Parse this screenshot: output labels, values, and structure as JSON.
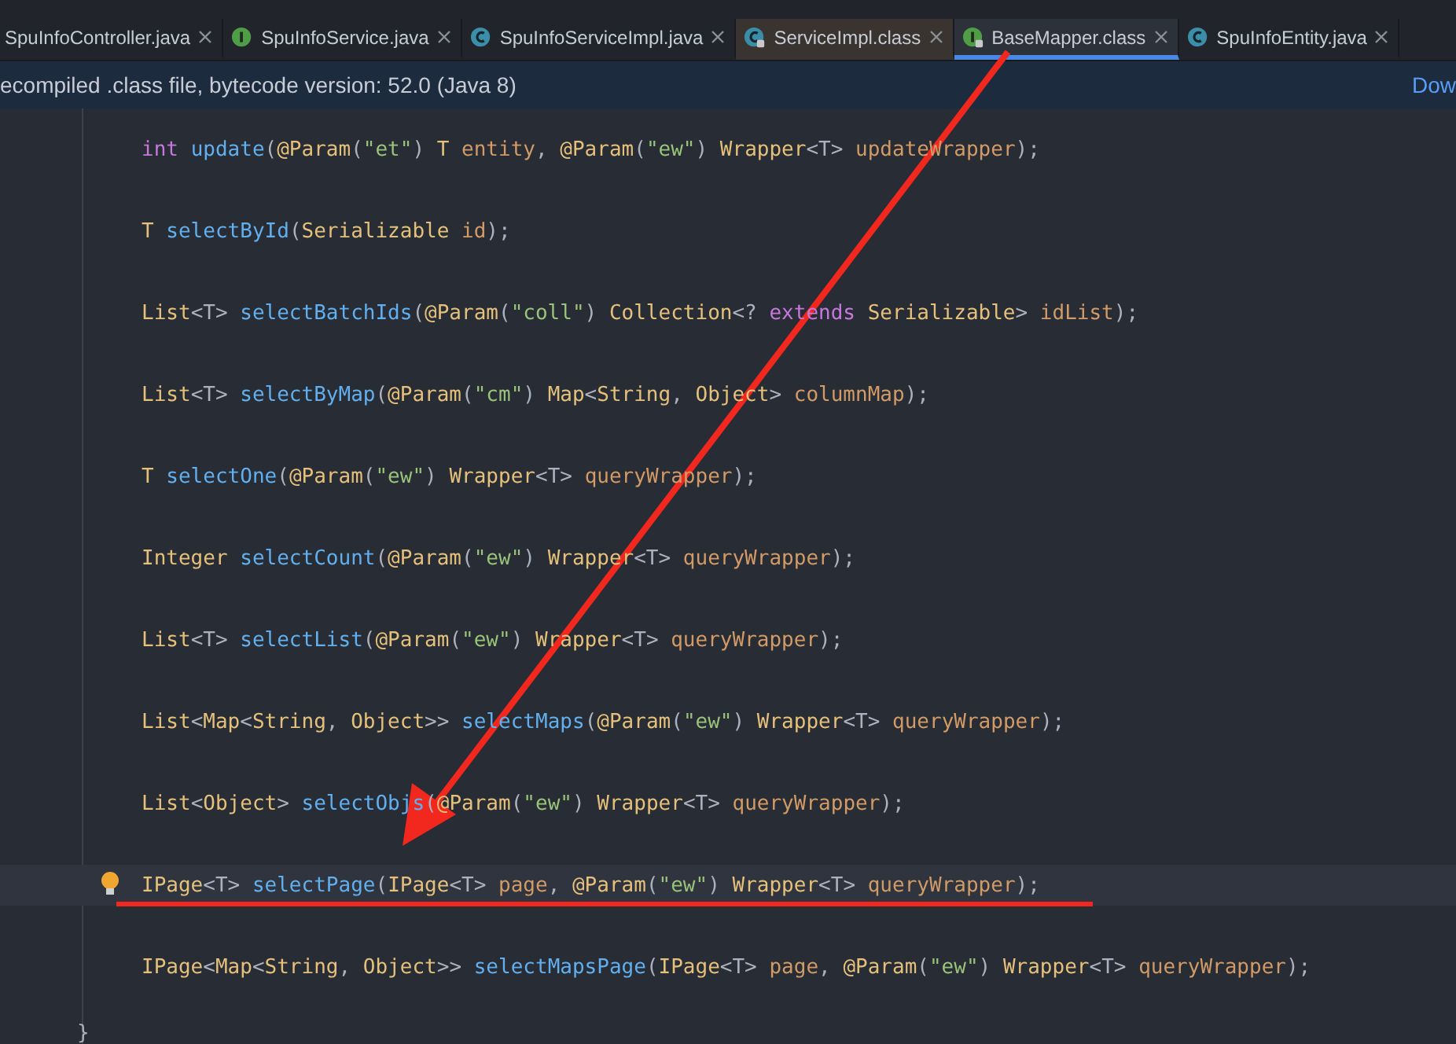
{
  "tabs": [
    {
      "label": "SpuInfoController.java",
      "kind": "none",
      "locked": false,
      "selected": false
    },
    {
      "label": "SpuInfoService.java",
      "kind": "interface",
      "locked": false,
      "selected": false
    },
    {
      "label": "SpuInfoServiceImpl.java",
      "kind": "class",
      "locked": false,
      "selected": false
    },
    {
      "label": "ServiceImpl.class",
      "kind": "class",
      "locked": true,
      "selected": false
    },
    {
      "label": "BaseMapper.class",
      "kind": "interface",
      "locked": true,
      "selected": true
    },
    {
      "label": "SpuInfoEntity.java",
      "kind": "class",
      "locked": false,
      "selected": false
    }
  ],
  "banner": {
    "text": "ecompiled .class file, bytecode version: 52.0 (Java 8)",
    "link": "Dow"
  },
  "code_lines": [
    {
      "current": false,
      "tokens": [
        {
          "kind": "kw",
          "text": "int "
        },
        {
          "kind": "fn",
          "text": "update"
        },
        {
          "kind": "p",
          "text": "("
        },
        {
          "kind": "ann",
          "text": "@Param"
        },
        {
          "kind": "p",
          "text": "("
        },
        {
          "kind": "str",
          "text": "\"et\""
        },
        {
          "kind": "p",
          "text": ") "
        },
        {
          "kind": "type",
          "text": "T "
        },
        {
          "kind": "var",
          "text": "entity"
        },
        {
          "kind": "p",
          "text": ", "
        },
        {
          "kind": "ann",
          "text": "@Param"
        },
        {
          "kind": "p",
          "text": "("
        },
        {
          "kind": "str",
          "text": "\"ew\""
        },
        {
          "kind": "p",
          "text": ") "
        },
        {
          "kind": "type",
          "text": "Wrapper"
        },
        {
          "kind": "p",
          "text": "<T> "
        },
        {
          "kind": "var",
          "text": "updateWrapper"
        },
        {
          "kind": "p",
          "text": ");"
        }
      ]
    },
    {
      "current": false,
      "tokens": [
        {
          "kind": "type",
          "text": "T "
        },
        {
          "kind": "fn",
          "text": "selectById"
        },
        {
          "kind": "p",
          "text": "("
        },
        {
          "kind": "type",
          "text": "Serializable "
        },
        {
          "kind": "var",
          "text": "id"
        },
        {
          "kind": "p",
          "text": ");"
        }
      ]
    },
    {
      "current": false,
      "tokens": [
        {
          "kind": "type",
          "text": "List"
        },
        {
          "kind": "p",
          "text": "<T> "
        },
        {
          "kind": "fn",
          "text": "selectBatchIds"
        },
        {
          "kind": "p",
          "text": "("
        },
        {
          "kind": "ann",
          "text": "@Param"
        },
        {
          "kind": "p",
          "text": "("
        },
        {
          "kind": "str",
          "text": "\"coll\""
        },
        {
          "kind": "p",
          "text": ") "
        },
        {
          "kind": "type",
          "text": "Collection"
        },
        {
          "kind": "p",
          "text": "<? "
        },
        {
          "kind": "kw",
          "text": "extends "
        },
        {
          "kind": "type",
          "text": "Serializable"
        },
        {
          "kind": "p",
          "text": "> "
        },
        {
          "kind": "var",
          "text": "idList"
        },
        {
          "kind": "p",
          "text": ");"
        }
      ]
    },
    {
      "current": false,
      "tokens": [
        {
          "kind": "type",
          "text": "List"
        },
        {
          "kind": "p",
          "text": "<T> "
        },
        {
          "kind": "fn",
          "text": "selectByMap"
        },
        {
          "kind": "p",
          "text": "("
        },
        {
          "kind": "ann",
          "text": "@Param"
        },
        {
          "kind": "p",
          "text": "("
        },
        {
          "kind": "str",
          "text": "\"cm\""
        },
        {
          "kind": "p",
          "text": ") "
        },
        {
          "kind": "type",
          "text": "Map"
        },
        {
          "kind": "p",
          "text": "<"
        },
        {
          "kind": "type",
          "text": "String"
        },
        {
          "kind": "p",
          "text": ", "
        },
        {
          "kind": "type",
          "text": "Object"
        },
        {
          "kind": "p",
          "text": "> "
        },
        {
          "kind": "var",
          "text": "columnMap"
        },
        {
          "kind": "p",
          "text": ");"
        }
      ]
    },
    {
      "current": false,
      "tokens": [
        {
          "kind": "type",
          "text": "T "
        },
        {
          "kind": "fn",
          "text": "selectOne"
        },
        {
          "kind": "p",
          "text": "("
        },
        {
          "kind": "ann",
          "text": "@Param"
        },
        {
          "kind": "p",
          "text": "("
        },
        {
          "kind": "str",
          "text": "\"ew\""
        },
        {
          "kind": "p",
          "text": ") "
        },
        {
          "kind": "type",
          "text": "Wrapper"
        },
        {
          "kind": "p",
          "text": "<T> "
        },
        {
          "kind": "var",
          "text": "queryWrapper"
        },
        {
          "kind": "p",
          "text": ");"
        }
      ]
    },
    {
      "current": false,
      "tokens": [
        {
          "kind": "type",
          "text": "Integer "
        },
        {
          "kind": "fn",
          "text": "selectCount"
        },
        {
          "kind": "p",
          "text": "("
        },
        {
          "kind": "ann",
          "text": "@Param"
        },
        {
          "kind": "p",
          "text": "("
        },
        {
          "kind": "str",
          "text": "\"ew\""
        },
        {
          "kind": "p",
          "text": ") "
        },
        {
          "kind": "type",
          "text": "Wrapper"
        },
        {
          "kind": "p",
          "text": "<T> "
        },
        {
          "kind": "var",
          "text": "queryWrapper"
        },
        {
          "kind": "p",
          "text": ");"
        }
      ]
    },
    {
      "current": false,
      "tokens": [
        {
          "kind": "type",
          "text": "List"
        },
        {
          "kind": "p",
          "text": "<T> "
        },
        {
          "kind": "fn",
          "text": "selectList"
        },
        {
          "kind": "p",
          "text": "("
        },
        {
          "kind": "ann",
          "text": "@Param"
        },
        {
          "kind": "p",
          "text": "("
        },
        {
          "kind": "str",
          "text": "\"ew\""
        },
        {
          "kind": "p",
          "text": ") "
        },
        {
          "kind": "type",
          "text": "Wrapper"
        },
        {
          "kind": "p",
          "text": "<T> "
        },
        {
          "kind": "var",
          "text": "queryWrapper"
        },
        {
          "kind": "p",
          "text": ");"
        }
      ]
    },
    {
      "current": false,
      "tokens": [
        {
          "kind": "type",
          "text": "List"
        },
        {
          "kind": "p",
          "text": "<"
        },
        {
          "kind": "type",
          "text": "Map"
        },
        {
          "kind": "p",
          "text": "<"
        },
        {
          "kind": "type",
          "text": "String"
        },
        {
          "kind": "p",
          "text": ", "
        },
        {
          "kind": "type",
          "text": "Object"
        },
        {
          "kind": "p",
          "text": ">> "
        },
        {
          "kind": "fn",
          "text": "selectMaps"
        },
        {
          "kind": "p",
          "text": "("
        },
        {
          "kind": "ann",
          "text": "@Param"
        },
        {
          "kind": "p",
          "text": "("
        },
        {
          "kind": "str",
          "text": "\"ew\""
        },
        {
          "kind": "p",
          "text": ") "
        },
        {
          "kind": "type",
          "text": "Wrapper"
        },
        {
          "kind": "p",
          "text": "<T> "
        },
        {
          "kind": "var",
          "text": "queryWrapper"
        },
        {
          "kind": "p",
          "text": ");"
        }
      ]
    },
    {
      "current": false,
      "tokens": [
        {
          "kind": "type",
          "text": "List"
        },
        {
          "kind": "p",
          "text": "<"
        },
        {
          "kind": "type",
          "text": "Object"
        },
        {
          "kind": "p",
          "text": "> "
        },
        {
          "kind": "fn",
          "text": "selectObjs"
        },
        {
          "kind": "p",
          "text": "("
        },
        {
          "kind": "ann",
          "text": "@Param"
        },
        {
          "kind": "p",
          "text": "("
        },
        {
          "kind": "str",
          "text": "\"ew\""
        },
        {
          "kind": "p",
          "text": ") "
        },
        {
          "kind": "type",
          "text": "Wrapper"
        },
        {
          "kind": "p",
          "text": "<T> "
        },
        {
          "kind": "var",
          "text": "queryWrapper"
        },
        {
          "kind": "p",
          "text": ");"
        }
      ]
    },
    {
      "current": true,
      "tokens": [
        {
          "kind": "type",
          "text": "IPage"
        },
        {
          "kind": "p",
          "text": "<T> "
        },
        {
          "kind": "fn",
          "text": "selectPage"
        },
        {
          "kind": "p",
          "text": "("
        },
        {
          "kind": "type",
          "text": "IPage"
        },
        {
          "kind": "p",
          "text": "<T> "
        },
        {
          "kind": "var",
          "text": "page"
        },
        {
          "kind": "p",
          "text": ", "
        },
        {
          "kind": "ann",
          "text": "@Param"
        },
        {
          "kind": "p",
          "text": "("
        },
        {
          "kind": "str",
          "text": "\"ew\""
        },
        {
          "kind": "p",
          "text": ") "
        },
        {
          "kind": "type",
          "text": "Wrapper"
        },
        {
          "kind": "p",
          "text": "<T> "
        },
        {
          "kind": "var",
          "text": "queryWrapper"
        },
        {
          "kind": "p",
          "text": ");"
        }
      ]
    },
    {
      "current": false,
      "tokens": [
        {
          "kind": "type",
          "text": "IPage"
        },
        {
          "kind": "p",
          "text": "<"
        },
        {
          "kind": "type",
          "text": "Map"
        },
        {
          "kind": "p",
          "text": "<"
        },
        {
          "kind": "type",
          "text": "String"
        },
        {
          "kind": "p",
          "text": ", "
        },
        {
          "kind": "type",
          "text": "Object"
        },
        {
          "kind": "p",
          "text": ">> "
        },
        {
          "kind": "fn",
          "text": "selectMapsPage"
        },
        {
          "kind": "p",
          "text": "("
        },
        {
          "kind": "type",
          "text": "IPage"
        },
        {
          "kind": "p",
          "text": "<T> "
        },
        {
          "kind": "var",
          "text": "page"
        },
        {
          "kind": "p",
          "text": ", "
        },
        {
          "kind": "ann",
          "text": "@Param"
        },
        {
          "kind": "p",
          "text": "("
        },
        {
          "kind": "str",
          "text": "\"ew\""
        },
        {
          "kind": "p",
          "text": ") "
        },
        {
          "kind": "type",
          "text": "Wrapper"
        },
        {
          "kind": "p",
          "text": "<T> "
        },
        {
          "kind": "var",
          "text": "queryWrapper"
        },
        {
          "kind": "p",
          "text": ");"
        }
      ]
    }
  ],
  "closing_brace": "}"
}
